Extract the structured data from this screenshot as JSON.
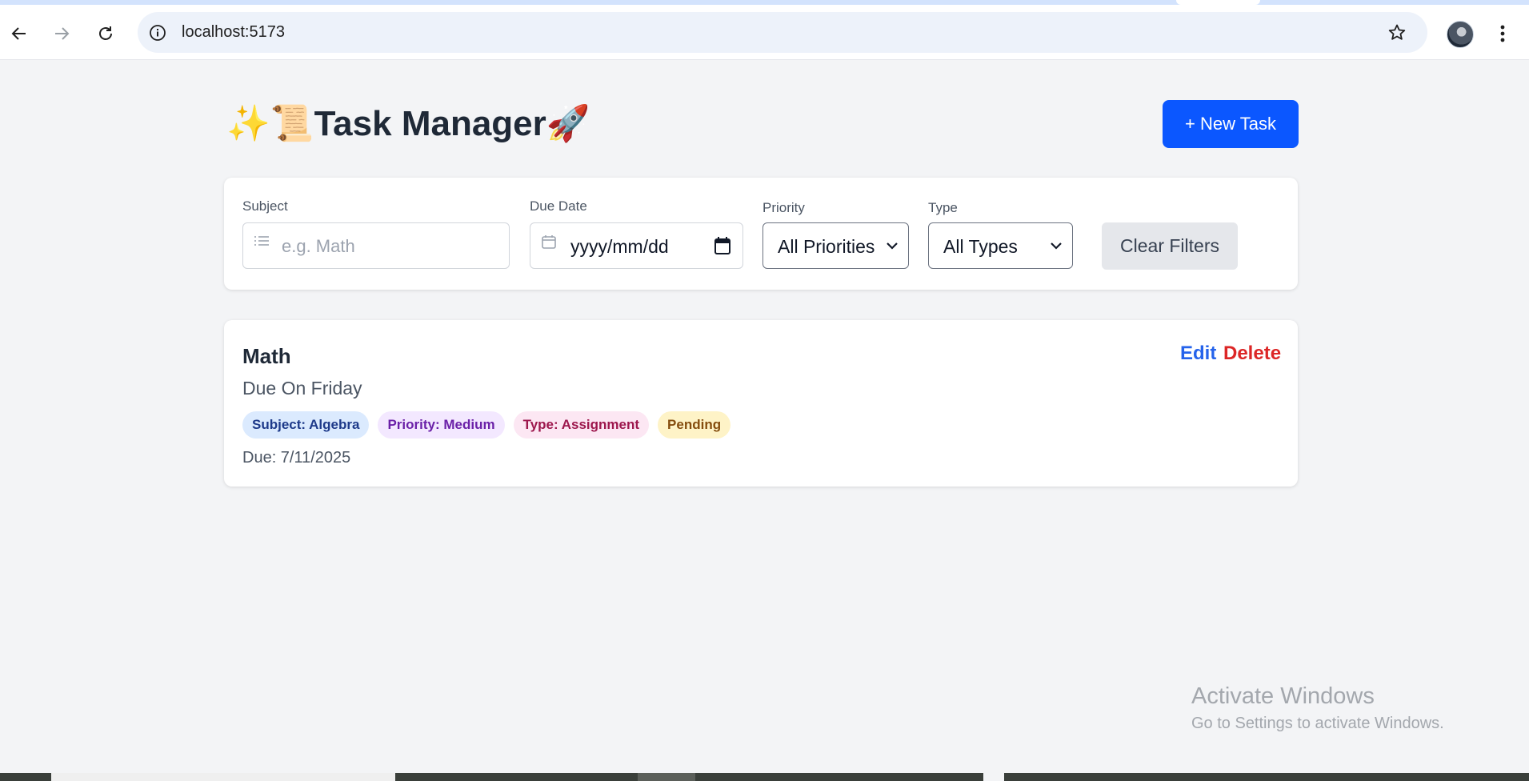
{
  "browser": {
    "url": "localhost:5173"
  },
  "app": {
    "title": "✨📜Task Manager🚀",
    "new_task_label": "+ New Task"
  },
  "filters": {
    "subject": {
      "label": "Subject",
      "placeholder": "e.g. Math"
    },
    "due_date": {
      "label": "Due Date",
      "placeholder": "yyyy/mm/dd"
    },
    "priority": {
      "label": "Priority",
      "selected": "All Priorities"
    },
    "type": {
      "label": "Type",
      "selected": "All Types"
    },
    "clear_label": "Clear Filters"
  },
  "tasks": [
    {
      "title": "Math",
      "description": "Due On Friday",
      "badges": [
        {
          "text": "Subject: Algebra",
          "bg": "#dbeafe",
          "fg": "#1e3a8a"
        },
        {
          "text": "Priority: Medium",
          "bg": "#f3e8ff",
          "fg": "#6b21a8"
        },
        {
          "text": "Type: Assignment",
          "bg": "#fce7f3",
          "fg": "#9d174d"
        },
        {
          "text": "Pending",
          "bg": "#fef3c7",
          "fg": "#854d0e"
        }
      ],
      "due": "Due: 7/11/2025",
      "edit_label": "Edit",
      "delete_label": "Delete"
    }
  ],
  "watermark": {
    "title": "Activate Windows",
    "subtitle": "Go to Settings to activate Windows."
  },
  "colors": {
    "primary": "#0b57ff",
    "edit": "#2563eb",
    "delete": "#dc2626",
    "page_bg": "#f3f4f6"
  }
}
